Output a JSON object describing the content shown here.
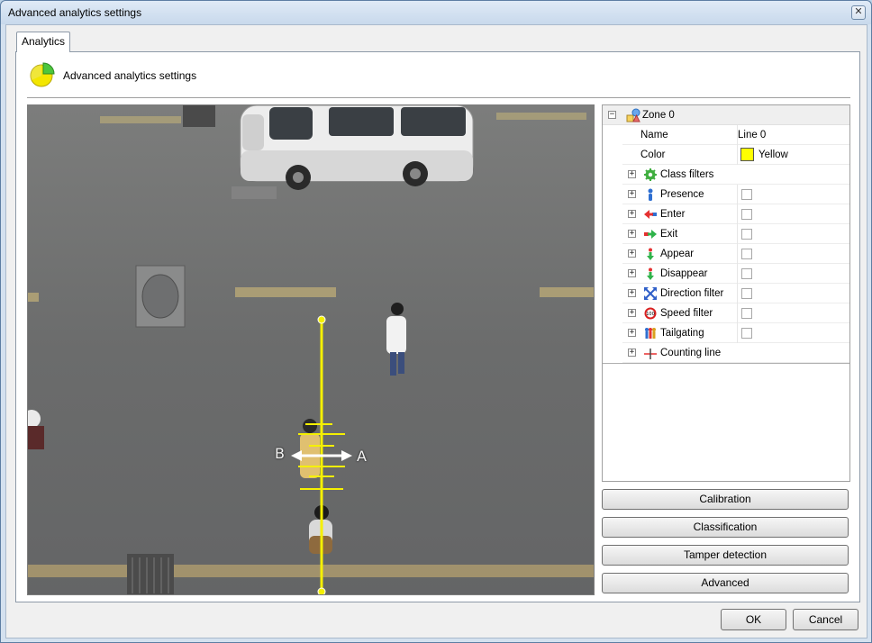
{
  "window": {
    "title": "Advanced analytics settings",
    "close_glyph": "✕"
  },
  "tabs": [
    {
      "label": "Analytics",
      "active": true
    }
  ],
  "header": {
    "title": "Advanced analytics settings",
    "icon": "pie-chart-icon"
  },
  "video": {
    "label_a": "A",
    "label_b": "B",
    "line_color": "#f5f000"
  },
  "zone": {
    "expander": "⊟",
    "label": "Zone 0",
    "icon": "zone-shapes-icon",
    "properties": [
      {
        "key": "name",
        "label": "Name",
        "value": "Line 0"
      },
      {
        "key": "color",
        "label": "Color",
        "value": "Yellow",
        "swatch": "#ffff00"
      }
    ],
    "items": [
      {
        "key": "class_filters",
        "label": "Class filters",
        "icon": "gear-icon",
        "has_checkbox": false
      },
      {
        "key": "presence",
        "label": "Presence",
        "icon": "person-icon",
        "has_checkbox": true,
        "checked": false
      },
      {
        "key": "enter",
        "label": "Enter",
        "icon": "enter-arrow-icon",
        "has_checkbox": true,
        "checked": false
      },
      {
        "key": "exit",
        "label": "Exit",
        "icon": "exit-arrow-icon",
        "has_checkbox": true,
        "checked": false
      },
      {
        "key": "appear",
        "label": "Appear",
        "icon": "appear-icon",
        "has_checkbox": true,
        "checked": false
      },
      {
        "key": "disappear",
        "label": "Disappear",
        "icon": "disappear-icon",
        "has_checkbox": true,
        "checked": false
      },
      {
        "key": "direction_filter",
        "label": "Direction filter",
        "icon": "direction-arrows-icon",
        "has_checkbox": true,
        "checked": false
      },
      {
        "key": "speed_filter",
        "label": "Speed filter",
        "icon": "speed-sign-icon",
        "icon_text": "100",
        "has_checkbox": true,
        "checked": false
      },
      {
        "key": "tailgating",
        "label": "Tailgating",
        "icon": "people-group-icon",
        "has_checkbox": true,
        "checked": false
      },
      {
        "key": "counting_line",
        "label": "Counting line",
        "icon": "counting-line-icon",
        "has_checkbox": false
      }
    ],
    "expander_glyph": "⊞"
  },
  "side_buttons": [
    "Calibration",
    "Classification",
    "Tamper detection",
    "Advanced"
  ],
  "footer": {
    "ok": "OK",
    "cancel": "Cancel"
  }
}
